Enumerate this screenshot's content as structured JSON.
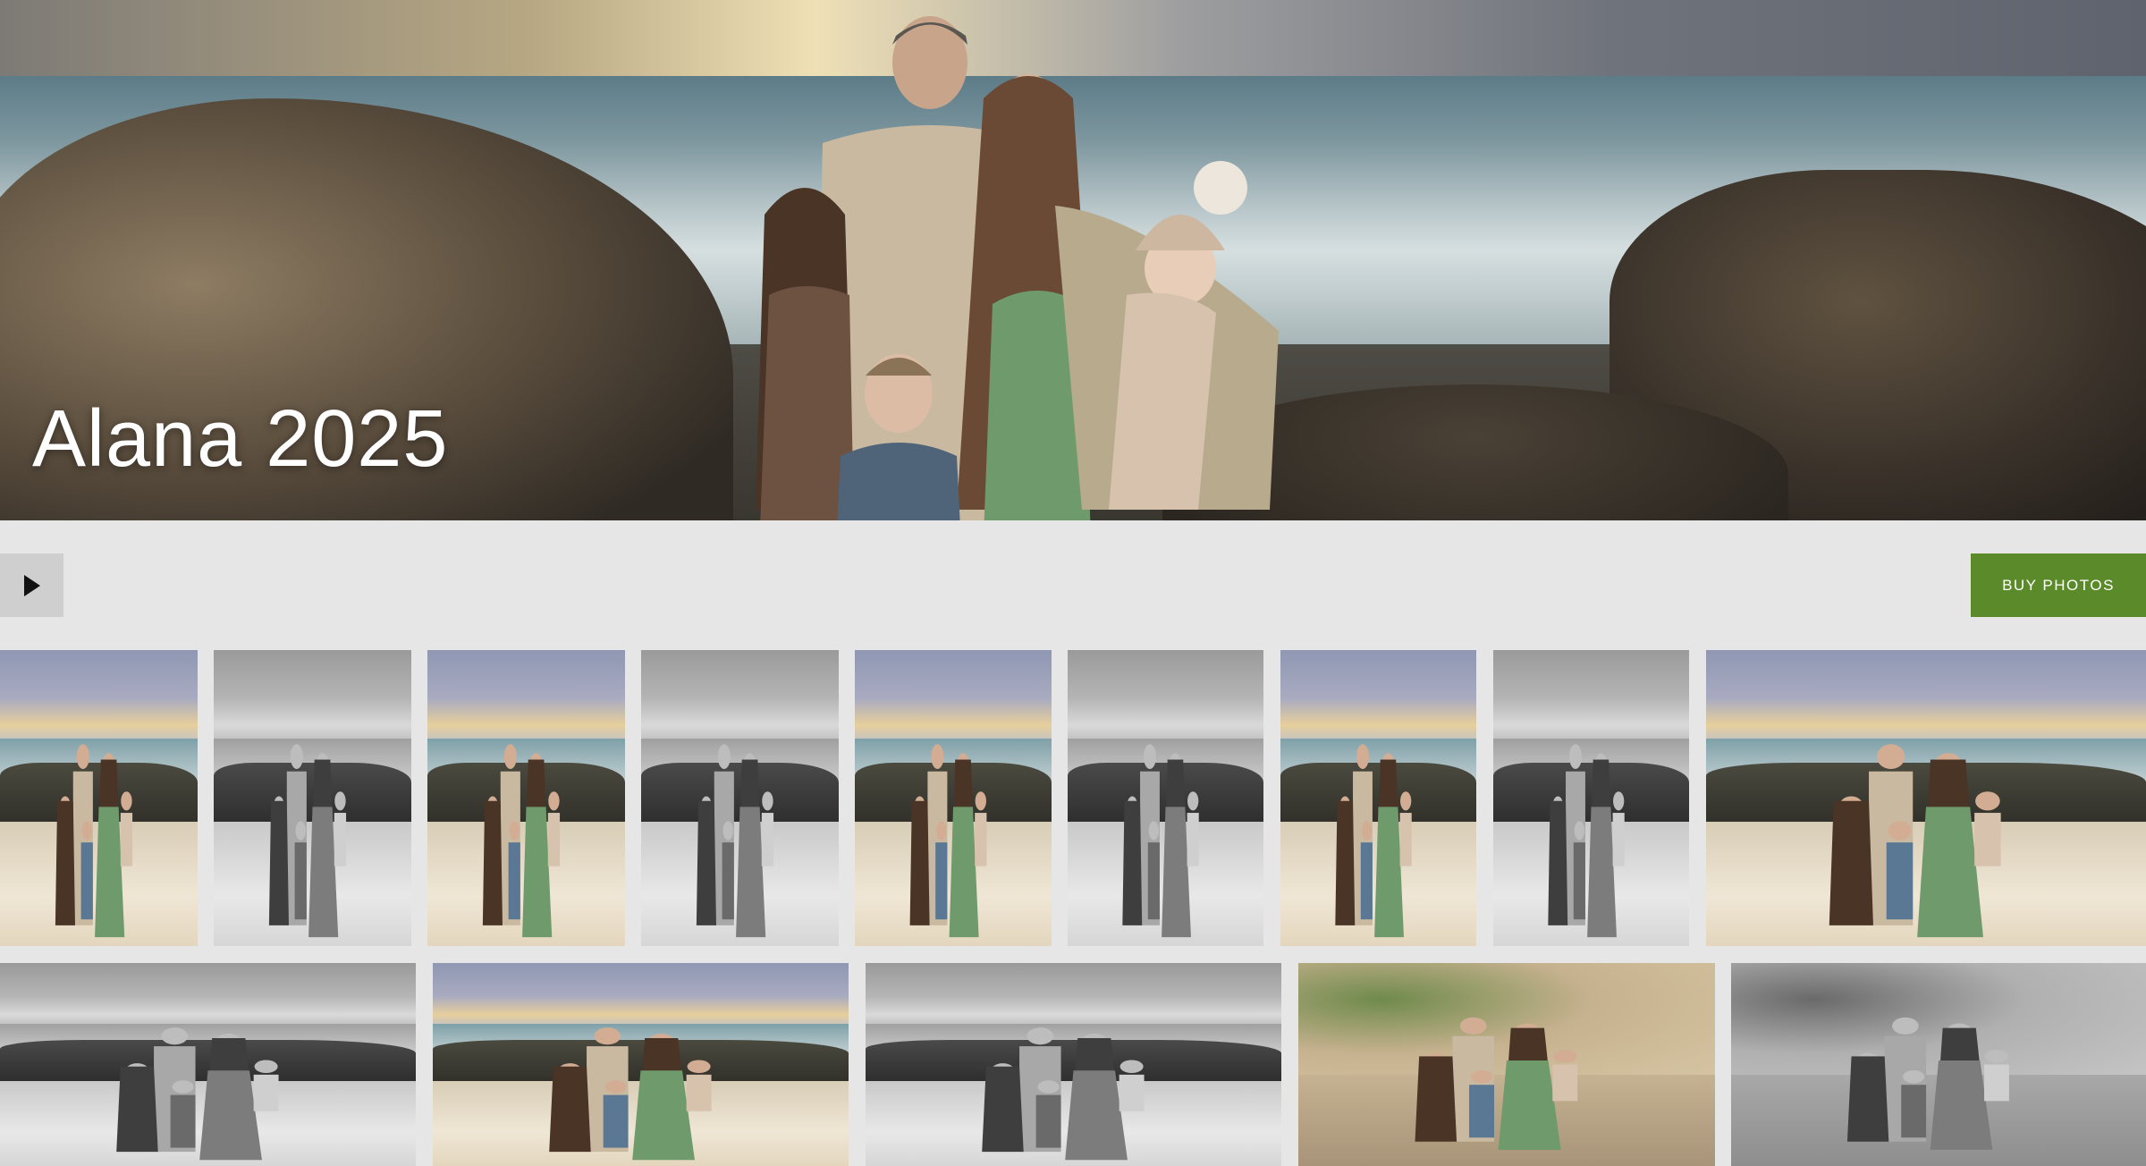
{
  "gallery": {
    "title": "Alana 2025"
  },
  "toolbar": {
    "play_icon": "play-icon",
    "buy_label": "BUY PHOTOS",
    "buy_color": "#5b8a2a"
  },
  "thumbnails": [
    {
      "name": "photo-1",
      "style": "color"
    },
    {
      "name": "photo-2",
      "style": "bw"
    },
    {
      "name": "photo-3",
      "style": "color"
    },
    {
      "name": "photo-4",
      "style": "bw"
    },
    {
      "name": "photo-5",
      "style": "color"
    },
    {
      "name": "photo-6",
      "style": "bw"
    },
    {
      "name": "photo-7",
      "style": "color"
    },
    {
      "name": "photo-8",
      "style": "bw"
    },
    {
      "name": "photo-9",
      "style": "color"
    },
    {
      "name": "photo-10",
      "style": "bw"
    },
    {
      "name": "photo-11",
      "style": "color"
    },
    {
      "name": "photo-12",
      "style": "bw"
    },
    {
      "name": "photo-13",
      "style": "color"
    },
    {
      "name": "photo-14",
      "style": "bw"
    }
  ]
}
